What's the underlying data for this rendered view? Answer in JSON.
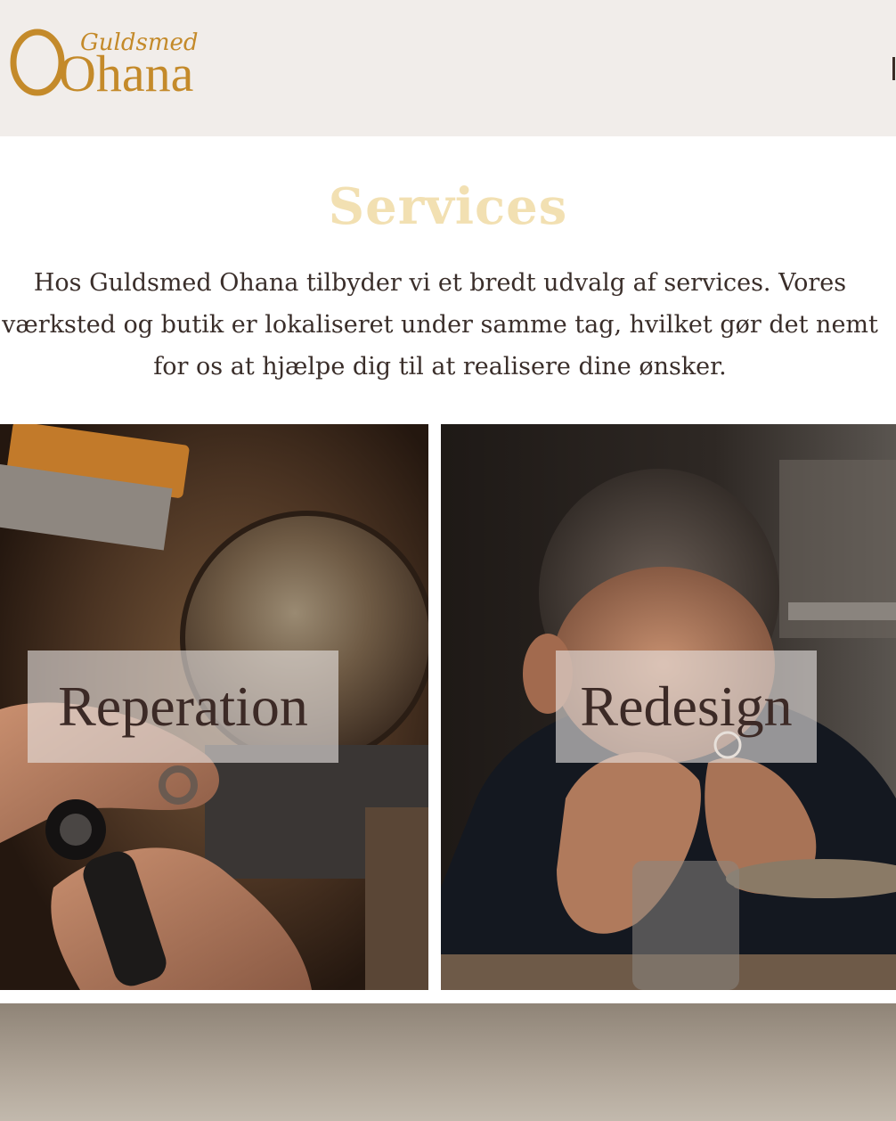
{
  "header": {
    "logo": {
      "script_text": "Guldsmed",
      "main_text": "Ohana",
      "color": "#c48a2a"
    }
  },
  "services": {
    "title": "Services",
    "description": "Hos Guldsmed Ohana tilbyder vi et bredt udvalg af services. Vores værksted og butik er lokaliseret under samme tag, hvilket gør det nemt for os at hjælpe dig til at realisere dine ønsker.",
    "title_color": "#f2e0b2"
  },
  "cards": [
    {
      "label": "Reperation",
      "image": "jeweler-repairing-ring-photo"
    },
    {
      "label": "Redesign",
      "image": "goldsmith-inspecting-ring-photo"
    }
  ]
}
